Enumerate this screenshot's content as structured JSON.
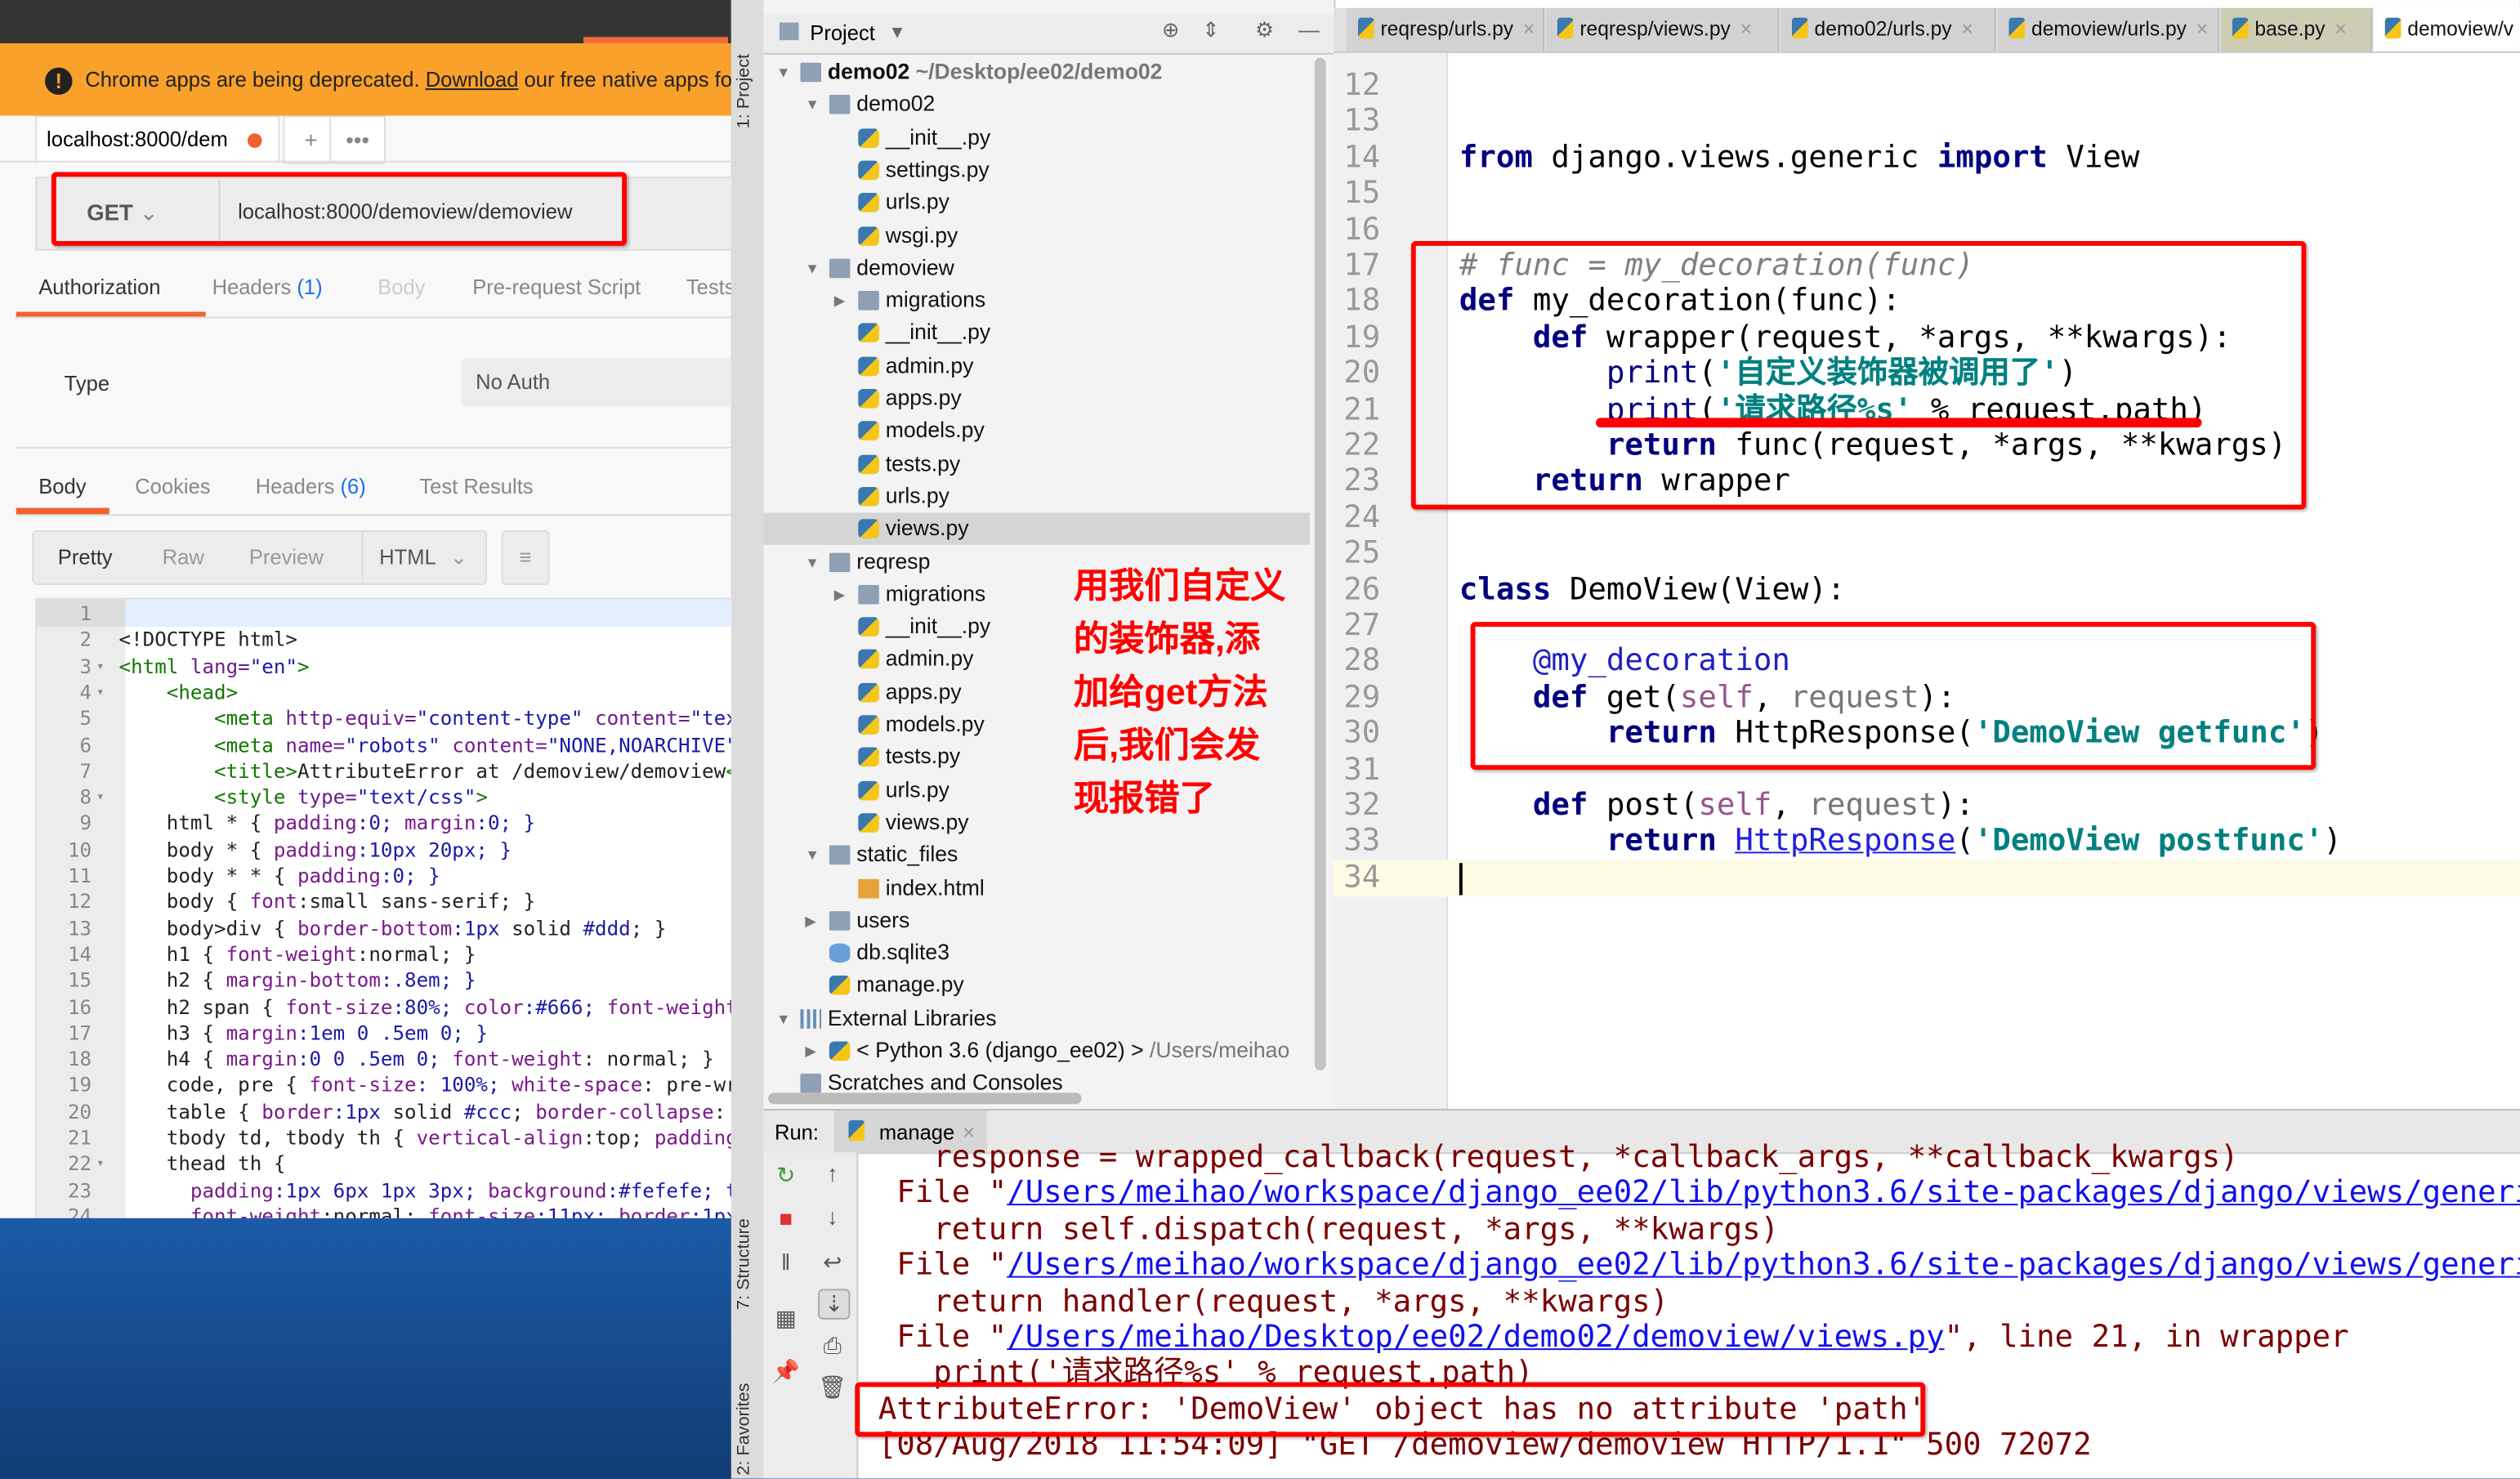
{
  "postman": {
    "banner": {
      "icon": "exclamation-icon",
      "pre": "Chrome apps are being deprecated. ",
      "link": "Download",
      "post": " our free native apps fo"
    },
    "request_tab": "localhost:8000/dem",
    "add_tab": "+",
    "more_tab": "•••",
    "method": "GET",
    "url": "localhost:8000/demoview/demoview",
    "req_tabs": [
      {
        "label": "Authorization",
        "count": ""
      },
      {
        "label": "Headers ",
        "count": "(1)"
      },
      {
        "label": "Body",
        "count": ""
      },
      {
        "label": "Pre-request Script",
        "count": ""
      },
      {
        "label": "Tests",
        "count": ""
      }
    ],
    "auth_type_label": "Type",
    "auth_type_value": "No Auth",
    "resp_tabs": [
      {
        "label": "Body",
        "count": ""
      },
      {
        "label": "Cookies",
        "count": ""
      },
      {
        "label": "Headers ",
        "count": "(6)"
      },
      {
        "label": "Test Results",
        "count": ""
      }
    ],
    "view_modes": [
      "Pretty",
      "Raw",
      "Preview"
    ],
    "format": "HTML",
    "code_lines": [
      {
        "n": "1",
        "f": "",
        "t": []
      },
      {
        "n": "2",
        "f": "",
        "t": [
          [
            "<!DOCTYPE html>",
            "txt"
          ]
        ]
      },
      {
        "n": "3",
        "f": "▾",
        "t": [
          [
            "<html ",
            "tag"
          ],
          [
            "lang=",
            "attr"
          ],
          [
            "\"en\"",
            "val"
          ],
          [
            ">",
            "tag"
          ]
        ]
      },
      {
        "n": "4",
        "f": "▾",
        "t": [
          [
            "    <head>",
            "tag"
          ]
        ]
      },
      {
        "n": "5",
        "f": "",
        "t": [
          [
            "        <meta ",
            "tag"
          ],
          [
            "http-equiv=",
            "attr"
          ],
          [
            "\"content-type\" ",
            "val"
          ],
          [
            "content=",
            "attr"
          ],
          [
            "\"tex",
            "val"
          ]
        ]
      },
      {
        "n": "6",
        "f": "",
        "t": [
          [
            "        <meta ",
            "tag"
          ],
          [
            "name=",
            "attr"
          ],
          [
            "\"robots\" ",
            "val"
          ],
          [
            "content=",
            "attr"
          ],
          [
            "\"NONE,NOARCHIVE\"",
            "val"
          ]
        ]
      },
      {
        "n": "7",
        "f": "",
        "t": [
          [
            "        <title>",
            "tag"
          ],
          [
            "AttributeError at /demoview/demoview",
            "txt"
          ],
          [
            "<",
            "tag"
          ]
        ]
      },
      {
        "n": "8",
        "f": "▾",
        "t": [
          [
            "        <style ",
            "tag"
          ],
          [
            "type=",
            "attr"
          ],
          [
            "\"text/css\"",
            "val"
          ],
          [
            ">",
            "tag"
          ]
        ]
      },
      {
        "n": "9",
        "f": "",
        "t": [
          [
            "    html * { ",
            "txt"
          ],
          [
            "padding",
            "prop"
          ],
          [
            ":0; ",
            "num"
          ],
          [
            "margin",
            "prop"
          ],
          [
            ":0; }",
            "num"
          ]
        ]
      },
      {
        "n": "10",
        "f": "",
        "t": [
          [
            "    body * { ",
            "txt"
          ],
          [
            "padding",
            "prop"
          ],
          [
            ":10px 20px; }",
            "num"
          ]
        ]
      },
      {
        "n": "11",
        "f": "",
        "t": [
          [
            "    body * * { ",
            "txt"
          ],
          [
            "padding",
            "prop"
          ],
          [
            ":0; }",
            "num"
          ]
        ]
      },
      {
        "n": "12",
        "f": "",
        "t": [
          [
            "    body { ",
            "txt"
          ],
          [
            "font",
            "prop"
          ],
          [
            ":small sans-serif; }",
            "txt"
          ]
        ]
      },
      {
        "n": "13",
        "f": "",
        "t": [
          [
            "    body>div { ",
            "txt"
          ],
          [
            "border-bottom",
            "prop"
          ],
          [
            ":1px ",
            "num"
          ],
          [
            "solid ",
            "txt"
          ],
          [
            "#ddd",
            "num"
          ],
          [
            "; }",
            "txt"
          ]
        ]
      },
      {
        "n": "14",
        "f": "",
        "t": [
          [
            "    h1 { ",
            "txt"
          ],
          [
            "font-weight",
            "prop"
          ],
          [
            ":normal; }",
            "txt"
          ]
        ]
      },
      {
        "n": "15",
        "f": "",
        "t": [
          [
            "    h2 { ",
            "txt"
          ],
          [
            "margin-bottom",
            "prop"
          ],
          [
            ":.8em; }",
            "num"
          ]
        ]
      },
      {
        "n": "16",
        "f": "",
        "t": [
          [
            "    h2 span { ",
            "txt"
          ],
          [
            "font-size",
            "prop"
          ],
          [
            ":80%; ",
            "num"
          ],
          [
            "color",
            "prop"
          ],
          [
            ":#666; ",
            "num"
          ],
          [
            "font-weight",
            "prop"
          ]
        ]
      },
      {
        "n": "17",
        "f": "",
        "t": [
          [
            "    h3 { ",
            "txt"
          ],
          [
            "margin",
            "prop"
          ],
          [
            ":1em 0 .5em 0; }",
            "num"
          ]
        ]
      },
      {
        "n": "18",
        "f": "",
        "t": [
          [
            "    h4 { ",
            "txt"
          ],
          [
            "margin",
            "prop"
          ],
          [
            ":0 0 .5em 0; ",
            "num"
          ],
          [
            "font-weight",
            "prop"
          ],
          [
            ": normal; }",
            "txt"
          ]
        ]
      },
      {
        "n": "19",
        "f": "",
        "t": [
          [
            "    code, pre { ",
            "txt"
          ],
          [
            "font-size",
            "prop"
          ],
          [
            ": 100%; ",
            "num"
          ],
          [
            "white-space",
            "prop"
          ],
          [
            ": pre-wr",
            "txt"
          ]
        ]
      },
      {
        "n": "20",
        "f": "",
        "t": [
          [
            "    table { ",
            "txt"
          ],
          [
            "border",
            "prop"
          ],
          [
            ":1px ",
            "num"
          ],
          [
            "solid ",
            "txt"
          ],
          [
            "#ccc",
            "num"
          ],
          [
            "; ",
            "txt"
          ],
          [
            "border-collapse",
            "prop"
          ],
          [
            ":",
            "txt"
          ]
        ]
      },
      {
        "n": "21",
        "f": "",
        "t": [
          [
            "    tbody td, tbody th { ",
            "txt"
          ],
          [
            "vertical-align",
            "prop"
          ],
          [
            ":top; ",
            "txt"
          ],
          [
            "padding",
            "prop"
          ]
        ]
      },
      {
        "n": "22",
        "f": "▾",
        "t": [
          [
            "    thead th {",
            "txt"
          ]
        ]
      },
      {
        "n": "23",
        "f": "",
        "t": [
          [
            "      padding",
            "prop"
          ],
          [
            ":1px 6px 1px 3px; ",
            "num"
          ],
          [
            "background",
            "prop"
          ],
          [
            ":#fefefe; t",
            "num"
          ]
        ]
      },
      {
        "n": "24",
        "f": "",
        "t": [
          [
            "      font-weight",
            "prop"
          ],
          [
            ":normal; ",
            "txt"
          ],
          [
            "font-size",
            "prop"
          ],
          [
            ":11px; ",
            "num"
          ],
          [
            "border",
            "prop"
          ],
          [
            ":1px",
            "num"
          ]
        ]
      }
    ]
  },
  "ide": {
    "side_labels": [
      "1: Project",
      "7: Structure",
      "2: Favorites"
    ],
    "project_header": "Project",
    "tree": [
      {
        "label": "demo02",
        "extra": " ~/Desktop/ee02/demo02",
        "d": 0,
        "icon": "folder",
        "arrow": "▼",
        "bold": true
      },
      {
        "label": "demo02",
        "extra": "",
        "d": 1,
        "icon": "folder",
        "arrow": "▼"
      },
      {
        "label": "__init__.py",
        "extra": "",
        "d": 2,
        "icon": "py",
        "arrow": ""
      },
      {
        "label": "settings.py",
        "extra": "",
        "d": 2,
        "icon": "py",
        "arrow": ""
      },
      {
        "label": "urls.py",
        "extra": "",
        "d": 2,
        "icon": "py",
        "arrow": ""
      },
      {
        "label": "wsgi.py",
        "extra": "",
        "d": 2,
        "icon": "py",
        "arrow": ""
      },
      {
        "label": "demoview",
        "extra": "",
        "d": 1,
        "icon": "folder",
        "arrow": "▼"
      },
      {
        "label": "migrations",
        "extra": "",
        "d": 2,
        "icon": "folder",
        "arrow": "▶"
      },
      {
        "label": "__init__.py",
        "extra": "",
        "d": 2,
        "icon": "py",
        "arrow": ""
      },
      {
        "label": "admin.py",
        "extra": "",
        "d": 2,
        "icon": "py",
        "arrow": ""
      },
      {
        "label": "apps.py",
        "extra": "",
        "d": 2,
        "icon": "py",
        "arrow": ""
      },
      {
        "label": "models.py",
        "extra": "",
        "d": 2,
        "icon": "py",
        "arrow": ""
      },
      {
        "label": "tests.py",
        "extra": "",
        "d": 2,
        "icon": "py",
        "arrow": ""
      },
      {
        "label": "urls.py",
        "extra": "",
        "d": 2,
        "icon": "py",
        "arrow": ""
      },
      {
        "label": "views.py",
        "extra": "",
        "d": 2,
        "icon": "py",
        "arrow": "",
        "selected": true
      },
      {
        "label": "reqresp",
        "extra": "",
        "d": 1,
        "icon": "folder",
        "arrow": "▼"
      },
      {
        "label": "migrations",
        "extra": "",
        "d": 2,
        "icon": "folder",
        "arrow": "▶"
      },
      {
        "label": "__init__.py",
        "extra": "",
        "d": 2,
        "icon": "py",
        "arrow": ""
      },
      {
        "label": "admin.py",
        "extra": "",
        "d": 2,
        "icon": "py",
        "arrow": ""
      },
      {
        "label": "apps.py",
        "extra": "",
        "d": 2,
        "icon": "py",
        "arrow": ""
      },
      {
        "label": "models.py",
        "extra": "",
        "d": 2,
        "icon": "py",
        "arrow": ""
      },
      {
        "label": "tests.py",
        "extra": "",
        "d": 2,
        "icon": "py",
        "arrow": ""
      },
      {
        "label": "urls.py",
        "extra": "",
        "d": 2,
        "icon": "py",
        "arrow": ""
      },
      {
        "label": "views.py",
        "extra": "",
        "d": 2,
        "icon": "py",
        "arrow": ""
      },
      {
        "label": "static_files",
        "extra": "",
        "d": 1,
        "icon": "folder",
        "arrow": "▼"
      },
      {
        "label": "index.html",
        "extra": "",
        "d": 2,
        "icon": "html",
        "arrow": ""
      },
      {
        "label": "users",
        "extra": "",
        "d": 1,
        "icon": "folder",
        "arrow": "▶"
      },
      {
        "label": "db.sqlite3",
        "extra": "",
        "d": 1,
        "icon": "db",
        "arrow": ""
      },
      {
        "label": "manage.py",
        "extra": "",
        "d": 1,
        "icon": "py",
        "arrow": ""
      },
      {
        "label": "External Libraries",
        "extra": "",
        "d": 0,
        "icon": "lib",
        "arrow": "▼"
      },
      {
        "label": "< Python 3.6 (django_ee02) >",
        "extra": " /Users/meihao",
        "d": 1,
        "icon": "py",
        "arrow": "▶"
      },
      {
        "label": "Scratches and Consoles",
        "extra": "",
        "d": 0,
        "icon": "folder",
        "arrow": ""
      }
    ],
    "editor_tabs": [
      "reqresp/urls.py",
      "reqresp/views.py",
      "demo02/urls.py",
      "demoview/urls.py",
      "base.py",
      "demoview/v"
    ],
    "editor_lines": [
      {
        "n": "12",
        "t": []
      },
      {
        "n": "13",
        "t": []
      },
      {
        "n": "14",
        "t": [
          [
            "from ",
            "kw"
          ],
          [
            "django.views.generic ",
            "id"
          ],
          [
            "import ",
            "kw"
          ],
          [
            "View",
            "id"
          ]
        ]
      },
      {
        "n": "15",
        "t": []
      },
      {
        "n": "16",
        "t": []
      },
      {
        "n": "17",
        "t": [
          [
            "# func = my_decoration(func)",
            "cm"
          ]
        ]
      },
      {
        "n": "18",
        "t": [
          [
            "def ",
            "kw"
          ],
          [
            "my_decoration(func):",
            "id"
          ]
        ]
      },
      {
        "n": "19",
        "t": [
          [
            "    def ",
            "kw"
          ],
          [
            "wrapper(request, *args, **kwargs):",
            "id"
          ]
        ]
      },
      {
        "n": "20",
        "t": [
          [
            "        print",
            "bi"
          ],
          [
            "(",
            "id"
          ],
          [
            "'自定义装饰器被调用了'",
            "str"
          ],
          [
            ")",
            "id"
          ]
        ]
      },
      {
        "n": "21",
        "t": [
          [
            "        print",
            "bi"
          ],
          [
            "(",
            "id"
          ],
          [
            "'请求路径%s'",
            "str"
          ],
          [
            " % request.path)",
            "id"
          ]
        ]
      },
      {
        "n": "22",
        "t": [
          [
            "        return ",
            "kw"
          ],
          [
            "func(request, *args, **kwargs)",
            "id"
          ]
        ]
      },
      {
        "n": "23",
        "t": [
          [
            "    return ",
            "kw"
          ],
          [
            "wrapper",
            "id"
          ]
        ]
      },
      {
        "n": "24",
        "t": []
      },
      {
        "n": "25",
        "t": []
      },
      {
        "n": "26",
        "t": [
          [
            "class ",
            "kw"
          ],
          [
            "DemoView(View):",
            "id"
          ]
        ]
      },
      {
        "n": "27",
        "t": []
      },
      {
        "n": "28",
        "t": [
          [
            "    @my_decoration",
            "dec"
          ]
        ]
      },
      {
        "n": "29",
        "t": [
          [
            "    def ",
            "kw"
          ],
          [
            "get(",
            "id"
          ],
          [
            "self",
            "self"
          ],
          [
            ", ",
            "id"
          ],
          [
            "request",
            "par"
          ],
          [
            "):",
            "id"
          ]
        ]
      },
      {
        "n": "30",
        "t": [
          [
            "        return ",
            "kw"
          ],
          [
            "HttpResponse(",
            "id"
          ],
          [
            "'DemoView getfunc'",
            "str"
          ],
          [
            ")",
            "id"
          ]
        ]
      },
      {
        "n": "31",
        "t": []
      },
      {
        "n": "32",
        "t": [
          [
            "    def ",
            "kw"
          ],
          [
            "post(",
            "id"
          ],
          [
            "self",
            "self"
          ],
          [
            ", ",
            "id"
          ],
          [
            "request",
            "par"
          ],
          [
            "):",
            "id"
          ]
        ]
      },
      {
        "n": "33",
        "t": [
          [
            "        return ",
            "kw"
          ],
          [
            "HttpResponse",
            "link"
          ],
          [
            "(",
            "id"
          ],
          [
            "'DemoView postfunc'",
            "str"
          ],
          [
            ")",
            "id"
          ]
        ]
      },
      {
        "n": "34",
        "t": []
      }
    ],
    "annotation": "用我们自定义\n的装饰器,添\n加给get方法\n后,我们会发\n现报错了",
    "run": {
      "label": "Run:",
      "tab": "manage",
      "lines": [
        {
          "pre": "    response = wrapped_callback(request, *callback_args, **callback_kwargs)",
          "link": "",
          "post": ""
        },
        {
          "pre": "  File \"",
          "link": "/Users/meihao/workspace/django_ee02/lib/python3.6/site-packages/django/views/generi",
          "post": ""
        },
        {
          "pre": "    return self.dispatch(request, *args, **kwargs)",
          "link": "",
          "post": ""
        },
        {
          "pre": "  File \"",
          "link": "/Users/meihao/workspace/django_ee02/lib/python3.6/site-packages/django/views/generi",
          "post": ""
        },
        {
          "pre": "    return handler(request, *args, **kwargs)",
          "link": "",
          "post": ""
        },
        {
          "pre": "  File \"",
          "link": "/Users/meihao/Desktop/ee02/demo02/demoview/views.py",
          "post": "\", line 21, in wrapper"
        },
        {
          "pre": "    print('请求路径%s' % request.path)",
          "link": "",
          "post": ""
        },
        {
          "pre": " AttributeError: 'DemoView' object has no attribute 'path'",
          "link": "",
          "post": ""
        },
        {
          "pre": " [08/Aug/2018 11:54:09] \"GET /demoview/demoview HTTP/1.1\" 500 72072",
          "link": "",
          "post": ""
        }
      ]
    }
  },
  "colors": {
    "postman_orange": "#f0622d",
    "banner": "#f9a12b",
    "highlight_red": "#ff0000",
    "keyword": "#000080",
    "string": "#008080",
    "console_text": "#7a0000"
  }
}
